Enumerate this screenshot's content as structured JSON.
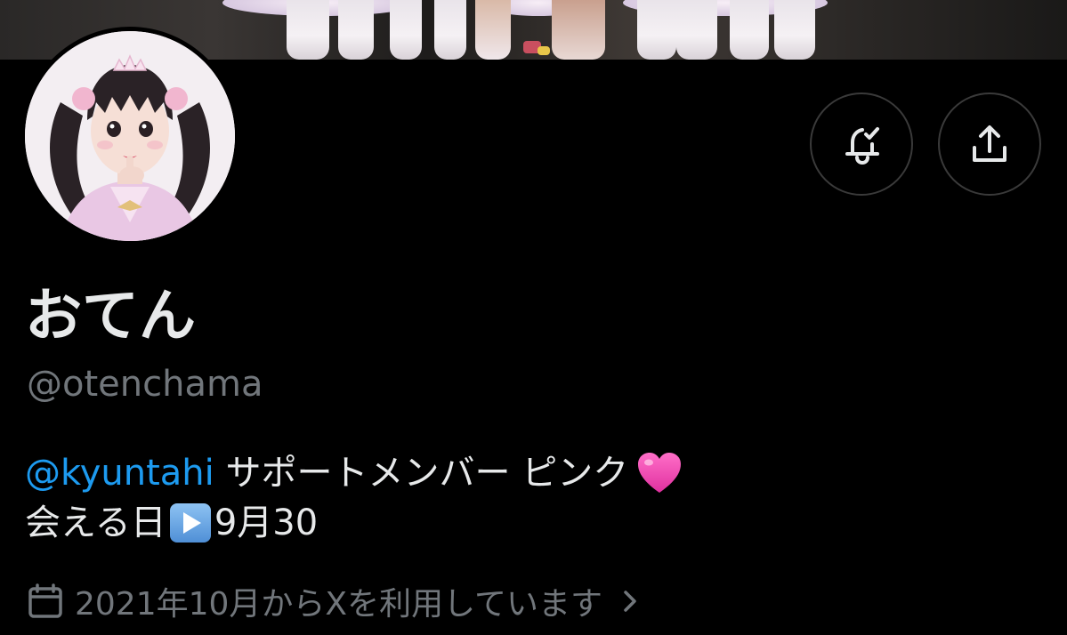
{
  "profile": {
    "display_name": "おてん",
    "handle": "@otenchama",
    "bio_mention": "@kyuntahi",
    "bio_line1_rest": " サポートメンバー ピンク",
    "bio_line1_emoji": "pink-heart",
    "bio_line2_prefix": "会える日",
    "bio_line2_emoji": "play-button",
    "bio_line2_suffix": "9月30",
    "joined_text": "2021年10月からXを利用しています"
  },
  "icons": {
    "notify": "bell-check-icon",
    "share": "share-upload-icon",
    "calendar": "calendar-icon",
    "chevron": "chevron-right-icon"
  },
  "colors": {
    "background": "#000000",
    "primary_text": "#e7e9ea",
    "secondary_text": "#71767b",
    "link": "#1d9bf0",
    "button_border": "#3a3a3a"
  }
}
